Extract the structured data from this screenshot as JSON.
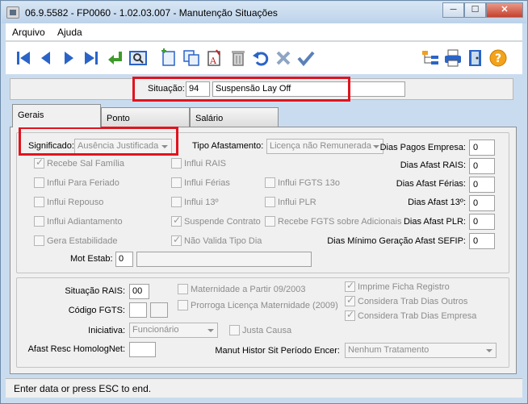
{
  "window": {
    "title": "06.9.5582 - FP0060 - 1.02.03.007 - Manutenção Situações",
    "minimize": "─",
    "maximize": "☐",
    "close": "✕"
  },
  "menu": [
    {
      "label": "Arquivo"
    },
    {
      "label": "Ajuda"
    }
  ],
  "toolbar": {
    "icons": [
      "first-icon",
      "prev-icon",
      "next-icon",
      "last-icon",
      "goto-icon",
      "search-icon",
      "add-icon",
      "copy-icon",
      "edit-icon",
      "delete-icon",
      "undo-icon",
      "cancel-icon",
      "confirm-icon",
      "tree-icon",
      "print-icon",
      "exit-icon",
      "help-icon"
    ]
  },
  "header": {
    "situacao_label": "Situação:",
    "situacao_code": "94",
    "situacao_desc": "Suspensão Lay Off"
  },
  "tabs": [
    {
      "label": "Gerais"
    },
    {
      "label": "Ponto"
    },
    {
      "label": "Salário"
    }
  ],
  "gerais": {
    "significado_label": "Significado:",
    "significado_value": "Ausência Justificada",
    "tipo_afastamento_label": "Tipo Afastamento:",
    "tipo_afastamento_value": "Licença não Remunerada",
    "checkboxes": {
      "recebe_sal_familia": "Recebe Sal Família",
      "influi_rais": "Influi RAIS",
      "influi_para_feriado": "Influi Para Feriado",
      "influi_ferias": "Influi Férias",
      "influi_fgts_13o": "Influi FGTS 13o",
      "influi_repouso": "Influi Repouso",
      "influi_13": "Influi 13º",
      "influi_plr": "Influi PLR",
      "influi_adiantamento": "Influi Adiantamento",
      "suspende_contrato": "Suspende Contrato",
      "recebe_fgts_adicionais": "Recebe FGTS sobre Adicionais",
      "gera_estabilidade": "Gera Estabilidade",
      "nao_valida_tipo_dia": "Não Valida Tipo Dia"
    },
    "dias": [
      {
        "label": "Dias Pagos Empresa:",
        "value": "0"
      },
      {
        "label": "Dias Afast RAIS:",
        "value": "0"
      },
      {
        "label": "Dias Afast Férias:",
        "value": "0"
      },
      {
        "label": "Dias Afast 13º:",
        "value": "0"
      },
      {
        "label": "Dias Afast PLR:",
        "value": "0"
      },
      {
        "label": "Dias Mínimo Geração Afast SEFIP:",
        "value": "0"
      }
    ],
    "mot_estab_label": "Mot Estab:",
    "mot_estab_code": "0",
    "mot_estab_desc": ""
  },
  "lower": {
    "situacao_rais_label": "Situação RAIS:",
    "situacao_rais_value": "00",
    "codigo_fgts_label": "Código FGTS:",
    "iniciativa_label": "Iniciativa:",
    "iniciativa_value": "Funcionário",
    "afast_resc_label": "Afast Resc HomologNet:",
    "maternidade_label": "Maternidade a Partir 09/2003",
    "prorroga_label": "Prorroga Licença Maternidade (2009)",
    "justa_causa_label": "Justa Causa",
    "imprime_ficha_label": "Imprime Ficha Registro",
    "considera_outros_label": "Considera Trab Dias Outros",
    "considera_empresa_label": "Considera Trab Dias Empresa",
    "manut_histor_label": "Manut Histor Sit Período Encer:",
    "manut_histor_value": "Nenhum Tratamento"
  },
  "status": {
    "text": "Enter data or press ESC to end."
  }
}
